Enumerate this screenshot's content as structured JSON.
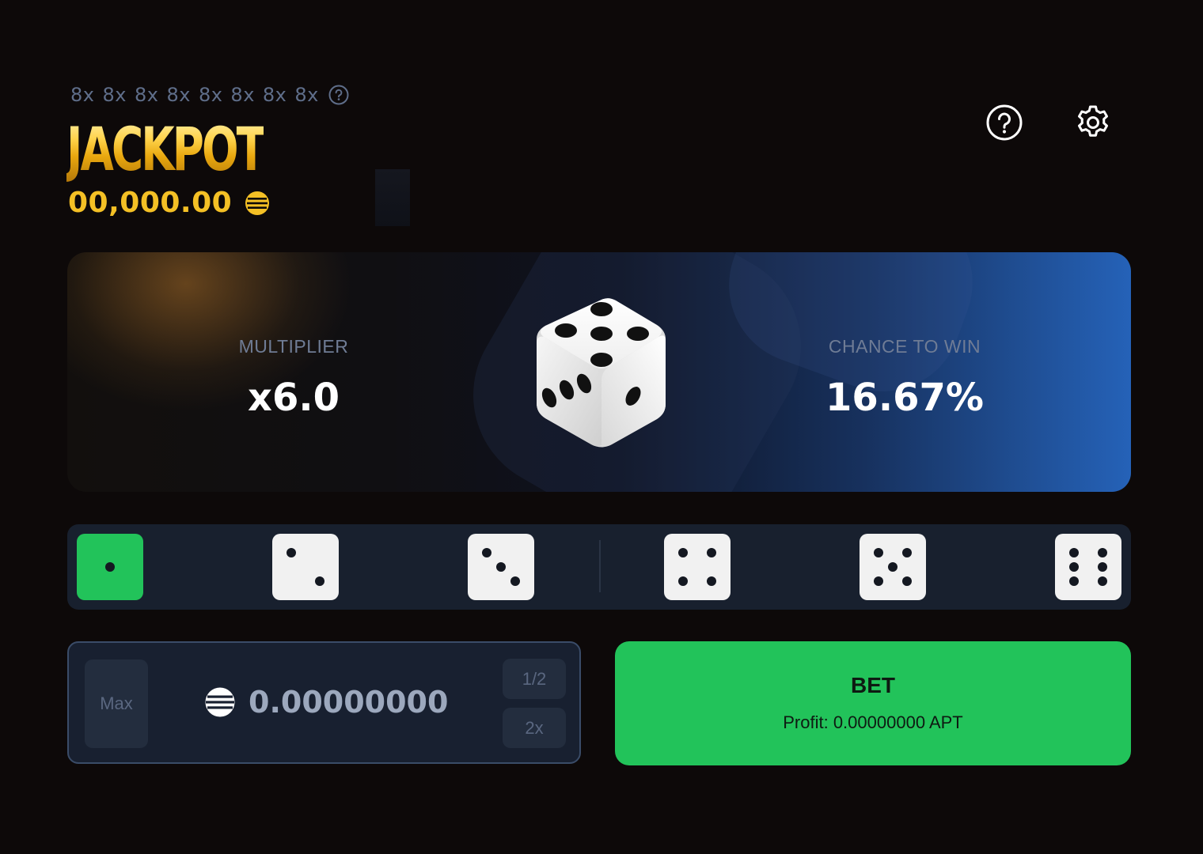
{
  "jackpot": {
    "multipliers": [
      "8x",
      "8x",
      "8x",
      "8x",
      "8x",
      "8x",
      "8x",
      "8x"
    ],
    "title": "JACKPOT",
    "amount": "00,000.00",
    "gold_color": "#f4c025"
  },
  "header": {
    "help_icon": "help-circle-icon",
    "settings_icon": "gear-icon"
  },
  "stats": {
    "multiplier_label": "MULTIPLIER",
    "multiplier_value": "x6.0",
    "chance_label": "CHANCE TO WIN",
    "chance_value": "16.67%"
  },
  "dice_selector": {
    "selected": 1,
    "options": [
      1,
      2,
      3,
      4,
      5,
      6
    ],
    "active_color": "#22c35a"
  },
  "bet_input": {
    "max_label": "Max",
    "half_label": "1/2",
    "double_label": "2x",
    "amount": "0.00000000",
    "coin_icon": "aptos-coin-icon"
  },
  "bet_button": {
    "label": "BET",
    "profit": "Profit: 0.00000000 APT",
    "color": "#22c35a"
  }
}
